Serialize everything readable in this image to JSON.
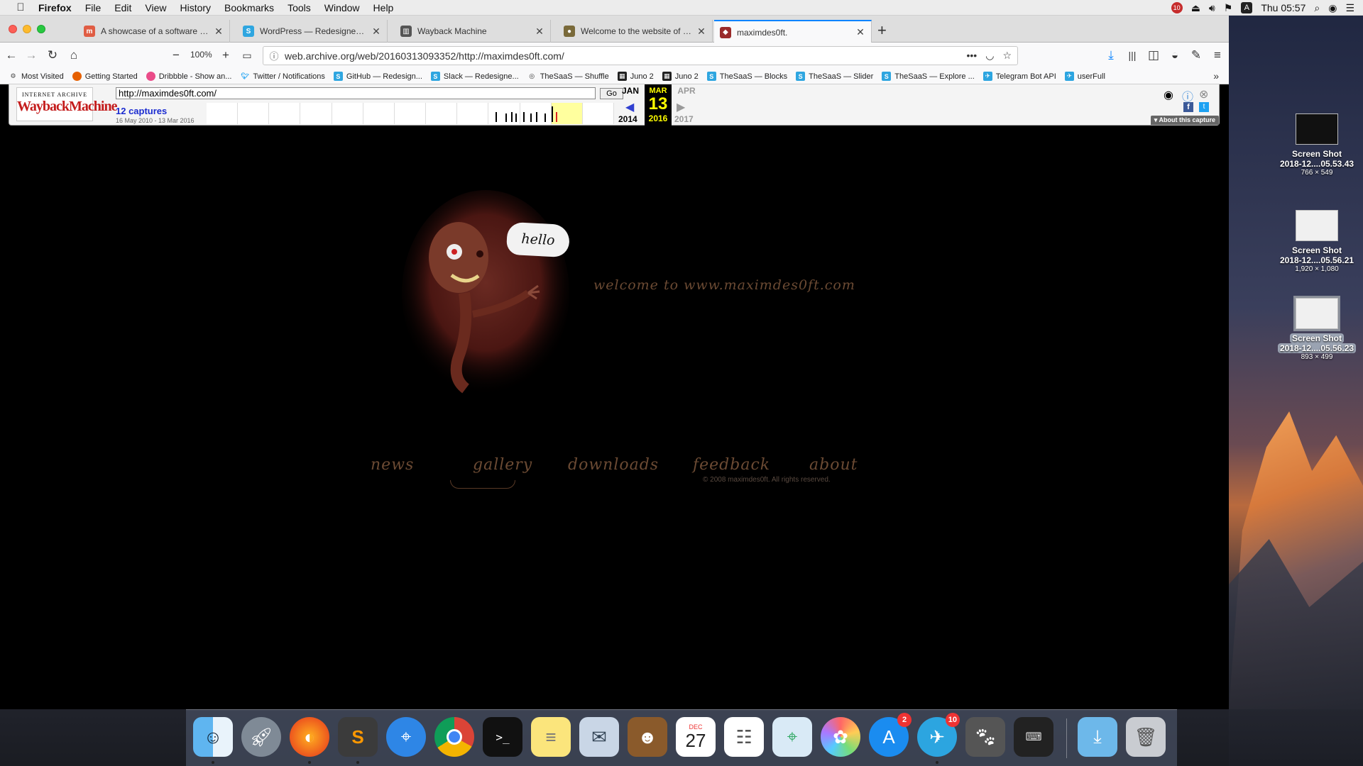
{
  "menubar": {
    "app": "Firefox",
    "items": [
      "File",
      "Edit",
      "View",
      "History",
      "Bookmarks",
      "Tools",
      "Window",
      "Help"
    ],
    "clock": "Thu 05:57",
    "notification_count": "10",
    "input_source": "A"
  },
  "tabs": [
    {
      "title": "A showcase of a software engin",
      "fav": "m",
      "color": "#e05d44"
    },
    {
      "title": "WordPress — Redesigned for d",
      "fav": "S",
      "color": "#2fa6e0"
    },
    {
      "title": "Wayback Machine",
      "fav": "▥",
      "color": "#555555"
    },
    {
      "title": "Welcome to the website of a de",
      "fav": "●",
      "color": "#7a6a3a"
    },
    {
      "title": "maximdes0ft.",
      "fav": "◆",
      "color": "#9a2a2a"
    }
  ],
  "navbar": {
    "zoom": "100%",
    "url": "web.archive.org/web/20160313093352/http://maximdes0ft.com/"
  },
  "bookmarks": [
    {
      "label": "Most Visited",
      "fav": "⚙",
      "color": "#666666"
    },
    {
      "label": "Getting Started",
      "fav": "●",
      "color": "#e66000"
    },
    {
      "label": "Dribbble - Show an...",
      "fav": "●",
      "color": "#ea4c89"
    },
    {
      "label": "Twitter / Notifications",
      "fav": "t",
      "color": "#1da1f2"
    },
    {
      "label": "GitHub — Redesign...",
      "fav": "S",
      "color": "#2fa6e0"
    },
    {
      "label": "Slack — Redesigne...",
      "fav": "S",
      "color": "#2fa6e0"
    },
    {
      "label": "TheSaaS — Shuffle",
      "fav": "◎",
      "color": "#444444"
    },
    {
      "label": "Juno 2",
      "fav": "▦",
      "color": "#222222"
    },
    {
      "label": "Juno 2",
      "fav": "▦",
      "color": "#222222"
    },
    {
      "label": "TheSaaS — Blocks",
      "fav": "S",
      "color": "#2fa6e0"
    },
    {
      "label": "TheSaaS — Slider",
      "fav": "S",
      "color": "#2fa6e0"
    },
    {
      "label": "TheSaaS — Explore ...",
      "fav": "S",
      "color": "#2fa6e0"
    },
    {
      "label": "Telegram Bot API",
      "fav": "✈",
      "color": "#2ca5e0"
    },
    {
      "label": "userFull",
      "fav": "✈",
      "color": "#2ca5e0"
    }
  ],
  "wayback": {
    "logo_top": "INTERNET ARCHIVE",
    "logo_main": "WaybackMachine",
    "url_value": "http://maximdes0ft.com/",
    "go_label": "Go",
    "captures": "12 captures",
    "range": "16 May 2010 - 13 Mar 2016",
    "prev_month": "JAN",
    "cur_month": "MAR",
    "next_month": "APR",
    "day": "13",
    "prev_year": "2014",
    "cur_year": "2016",
    "next_year": "2017",
    "about": "About this capture"
  },
  "site": {
    "hello": "hello",
    "welcome": "welcome  to  www.maximdes0ft.com",
    "nav": [
      "news",
      "gallery",
      "downloads",
      "feedback",
      "about"
    ],
    "copyright": "© 2008 maximdes0ft. All rights reserved."
  },
  "desktop_icons": [
    {
      "name": "Screen Shot",
      "file": "2018-12....05.53.43",
      "dim": "766 × 549"
    },
    {
      "name": "Screen Shot",
      "file": "2018-12....05.56.21",
      "dim": "1,920 × 1,080"
    },
    {
      "name": "Screen Shot",
      "file": "2018-12....05.56.23",
      "dim": "893 × 499"
    }
  ],
  "dock": {
    "calendar_month": "DEC",
    "calendar_day": "27",
    "appstore_badge": "2",
    "telegram_badge": "10"
  }
}
